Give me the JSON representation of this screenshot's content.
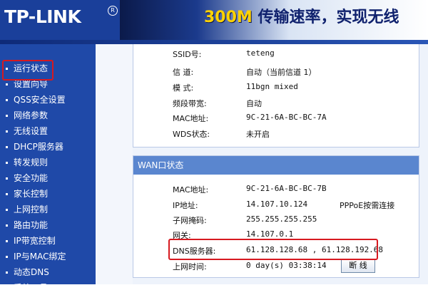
{
  "header": {
    "logo_text": "TP-LINK",
    "registered_mark": "R",
    "slogan_num": "300M",
    "slogan_text": "传输速率，实现无线"
  },
  "sidebar": {
    "items": [
      {
        "label": "运行状态"
      },
      {
        "label": "设置向导"
      },
      {
        "label": "QSS安全设置"
      },
      {
        "label": "网络参数"
      },
      {
        "label": "无线设置"
      },
      {
        "label": "DHCP服务器"
      },
      {
        "label": "转发规则"
      },
      {
        "label": "安全功能"
      },
      {
        "label": "家长控制"
      },
      {
        "label": "上网控制"
      },
      {
        "label": "路由功能"
      },
      {
        "label": "IP带宽控制"
      },
      {
        "label": "IP与MAC绑定"
      },
      {
        "label": "动态DNS"
      },
      {
        "label": "系统工具"
      }
    ]
  },
  "wireless": {
    "ssid_label": "SSID号:",
    "ssid_value": "teteng",
    "channel_label": "信  道:",
    "channel_value": "自动（当前信道 1）",
    "mode_label": "模  式:",
    "mode_value": "11bgn mixed",
    "bandwidth_label": "频段带宽:",
    "bandwidth_value": "自动",
    "mac_label": "MAC地址:",
    "mac_value": "9C-21-6A-BC-BC-7A",
    "wds_label": "WDS状态:",
    "wds_value": "未开启"
  },
  "wan": {
    "title": "WAN口状态",
    "mac_label": "MAC地址:",
    "mac_value": "9C-21-6A-BC-BC-7B",
    "ip_label": "IP地址:",
    "ip_value": "14.107.10.124",
    "conn_type": "PPPoE按需连接",
    "mask_label": "子网掩码:",
    "mask_value": "255.255.255.255",
    "gateway_label": "网关:",
    "gateway_value": "14.107.0.1",
    "dns_label": "DNS服务器:",
    "dns_value": "61.128.128.68 , 61.128.192.68",
    "uptime_label": "上网时间:",
    "uptime_value": "0 day(s) 03:38:14",
    "disconnect_label": "断 线"
  }
}
